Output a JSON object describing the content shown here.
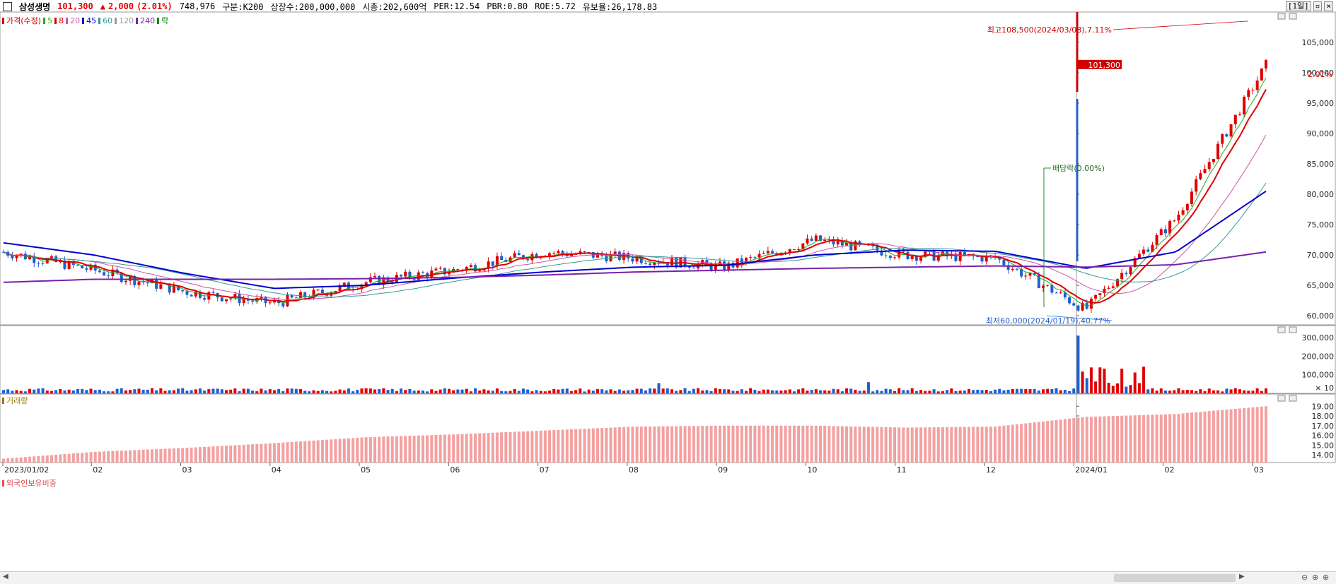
{
  "header": {
    "stock_name": "삼성생명",
    "price": "101,300",
    "change_arrow": "▲",
    "change": "2,000",
    "change_pct": "(2.01%)",
    "volume": "748,976",
    "segment": "구분:K200",
    "listed_shares": "상장수:200,000,000",
    "market_cap": "시총:202,600억",
    "per": "PER:12.54",
    "pbr": "PBR:0.80",
    "roe": "ROE:5.72",
    "float_ratio": "유보율:26,178.83",
    "period": "[1일]"
  },
  "legends": {
    "price": [
      {
        "label": "가격(수정)",
        "color": "#d00000"
      },
      {
        "label": "5",
        "color": "#22aa22"
      },
      {
        "label": "8",
        "color": "#dd0000"
      },
      {
        "label": "20",
        "color": "#cc55aa"
      },
      {
        "label": "45",
        "color": "#0000cc"
      },
      {
        "label": "60",
        "color": "#339999"
      },
      {
        "label": "120",
        "color": "#999999"
      },
      {
        "label": "240",
        "color": "#7722aa"
      },
      {
        "label": "락",
        "color": "#008800"
      }
    ],
    "volume": {
      "label": "거래량",
      "color": "#9a7b00"
    },
    "foreign": {
      "label": "외국인보유비중",
      "color": "#e05050"
    }
  },
  "annotations": {
    "high": "최고108,500(2024/03/08),7.11%",
    "low": "최저60,000(2024/01/19),40.77%",
    "dividend": "배당락(0.00%)",
    "current_price": "101,300",
    "current_pct": "2.01%",
    "volume_unit": "× 10"
  },
  "colors": {
    "up": "#e00000",
    "down": "#1f5fd0",
    "ma5": "#22aa22",
    "ma8": "#dd0000",
    "ma20": "#cc55aa",
    "ma45": "#0000cc",
    "ma60": "#339999",
    "ma240": "#7722aa",
    "foreign": "#f4a0a0"
  },
  "chart_data": [
    {
      "type": "line",
      "title": "",
      "xlabel": "",
      "ylabel": "",
      "ylim": [
        58500,
        110000
      ],
      "yticks": [
        60000,
        65000,
        70000,
        75000,
        80000,
        85000,
        90000,
        95000,
        100000,
        105000
      ],
      "ytick_labels": [
        "60,000",
        "65,000",
        "70,000",
        "75,000",
        "80,000",
        "85,000",
        "90,000",
        "95,000",
        "100,000",
        "105,000"
      ],
      "x_tick_labels": [
        "2023/01/02",
        "02",
        "03",
        "04",
        "05",
        "06",
        "07",
        "08",
        "09",
        "10",
        "11",
        "12",
        "2024/01",
        "02",
        "03"
      ],
      "x": [
        "2023-01",
        "2023-02",
        "2023-03",
        "2023-04",
        "2023-05",
        "2023-06",
        "2023-07",
        "2023-08",
        "2023-09",
        "2023-10",
        "2023-11",
        "2023-12",
        "2024-01",
        "2024-02",
        "2024-03"
      ],
      "series": [
        {
          "name": "가격(수정)",
          "values": [
            70500,
            67500,
            64000,
            62000,
            65500,
            67500,
            70500,
            69500,
            68000,
            72500,
            70000,
            69500,
            61000,
            76000,
            101300
          ]
        },
        {
          "name": "45",
          "values": [
            72000,
            70000,
            67000,
            64500,
            65000,
            66200,
            67200,
            68000,
            68300,
            70000,
            70800,
            70600,
            67800,
            70500,
            80500
          ]
        },
        {
          "name": "240",
          "values": [
            65500,
            66000,
            66000,
            66000,
            66100,
            66300,
            66700,
            67200,
            67500,
            67800,
            68000,
            68200,
            68000,
            68400,
            70500
          ]
        }
      ],
      "high": 108500,
      "low": 60000
    },
    {
      "type": "bar",
      "title": "",
      "ylabel": "",
      "ylim": [
        0,
        330000
      ],
      "ytick_labels": [
        "100,000",
        "200,000",
        "300,000"
      ],
      "values_approx": {
        "typical": 20000,
        "spike_2024_01": 310000,
        "max_2024_02": 180000
      }
    },
    {
      "type": "bar",
      "title": "",
      "ylabel": "",
      "ylim": [
        13.2,
        19.6
      ],
      "ytick_labels": [
        "14.00",
        "15.00",
        "16.00",
        "17.00",
        "18.00",
        "19.00"
      ],
      "x": [
        "2023-01",
        "2023-02",
        "2023-03",
        "2023-04",
        "2023-05",
        "2023-06",
        "2023-07",
        "2023-08",
        "2023-09",
        "2023-10",
        "2023-11",
        "2023-12",
        "2024-01",
        "2024-02",
        "2024-03"
      ],
      "values": [
        13.6,
        14.3,
        14.7,
        15.2,
        15.8,
        16.1,
        16.5,
        16.9,
        17.0,
        17.0,
        16.8,
        16.9,
        17.9,
        18.2,
        19.0
      ]
    }
  ]
}
